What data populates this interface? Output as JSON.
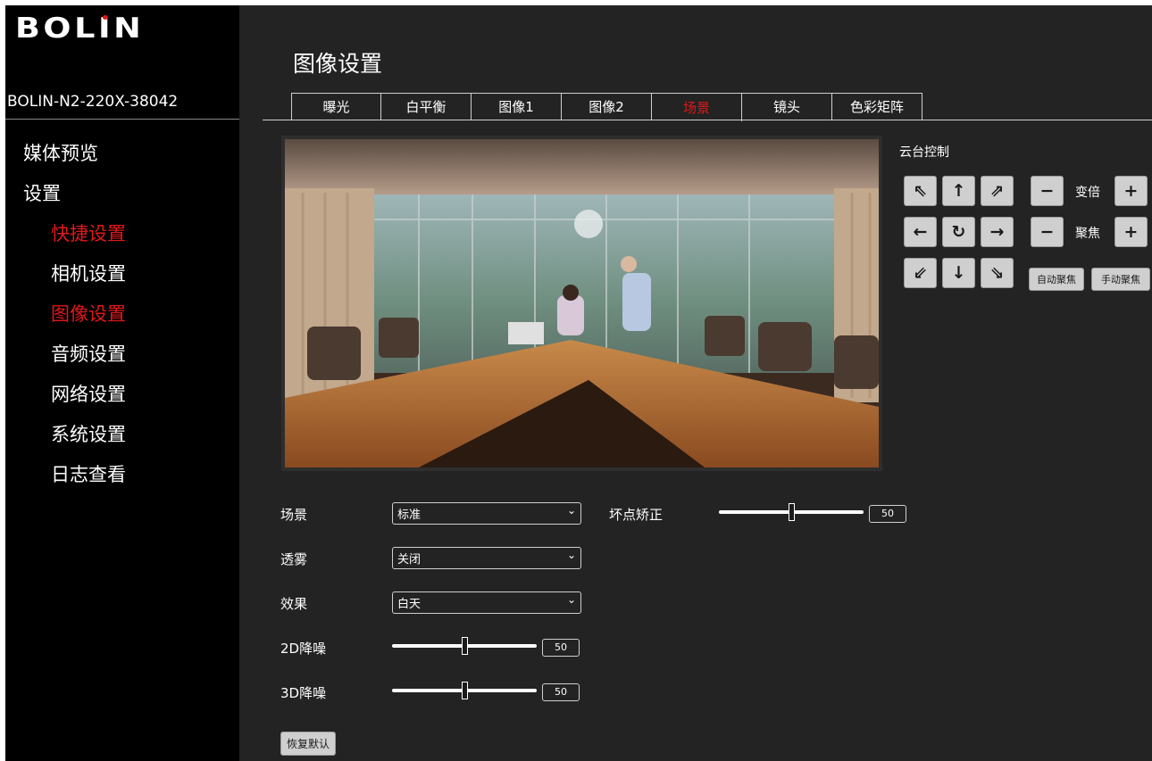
{
  "brand": {
    "logo_text": "BOLIN",
    "device_name": "BOLIN-N2-220X-38042"
  },
  "sidebar": {
    "items": [
      {
        "label": "媒体预览",
        "level": 1,
        "active": false
      },
      {
        "label": "设置",
        "level": 1,
        "active": false
      },
      {
        "label": "快捷设置",
        "level": 2,
        "active": true
      },
      {
        "label": "相机设置",
        "level": 2,
        "active": false
      },
      {
        "label": "图像设置",
        "level": 2,
        "active": true
      },
      {
        "label": "音频设置",
        "level": 2,
        "active": false
      },
      {
        "label": "网络设置",
        "level": 2,
        "active": false
      },
      {
        "label": "系统设置",
        "level": 2,
        "active": false
      },
      {
        "label": "日志查看",
        "level": 2,
        "active": false
      }
    ]
  },
  "main": {
    "title": "图像设置",
    "tabs": [
      {
        "label": "曝光",
        "active": false
      },
      {
        "label": "白平衡",
        "active": false
      },
      {
        "label": "图像1",
        "active": false
      },
      {
        "label": "图像2",
        "active": false
      },
      {
        "label": "场景",
        "active": true
      },
      {
        "label": "镜头",
        "active": false
      },
      {
        "label": "色彩矩阵",
        "active": false
      }
    ]
  },
  "ptz": {
    "title": "云台控制",
    "zoom_label": "变倍",
    "focus_label": "聚焦",
    "auto_focus": "自动聚焦",
    "manual_focus": "手动聚焦"
  },
  "form": {
    "scene": {
      "label": "场景",
      "value": "标准"
    },
    "defog": {
      "label": "透雾",
      "value": "关闭"
    },
    "effect": {
      "label": "效果",
      "value": "白天"
    },
    "nr2d": {
      "label": "2D降噪",
      "value": 50
    },
    "nr3d": {
      "label": "3D降噪",
      "value": 50
    },
    "dead_pixel": {
      "label": "坏点矫正",
      "value": 50
    },
    "reset_label": "恢复默认"
  },
  "colors": {
    "accent": "#e01818",
    "panel": "#232323",
    "sidebar": "#000000"
  }
}
